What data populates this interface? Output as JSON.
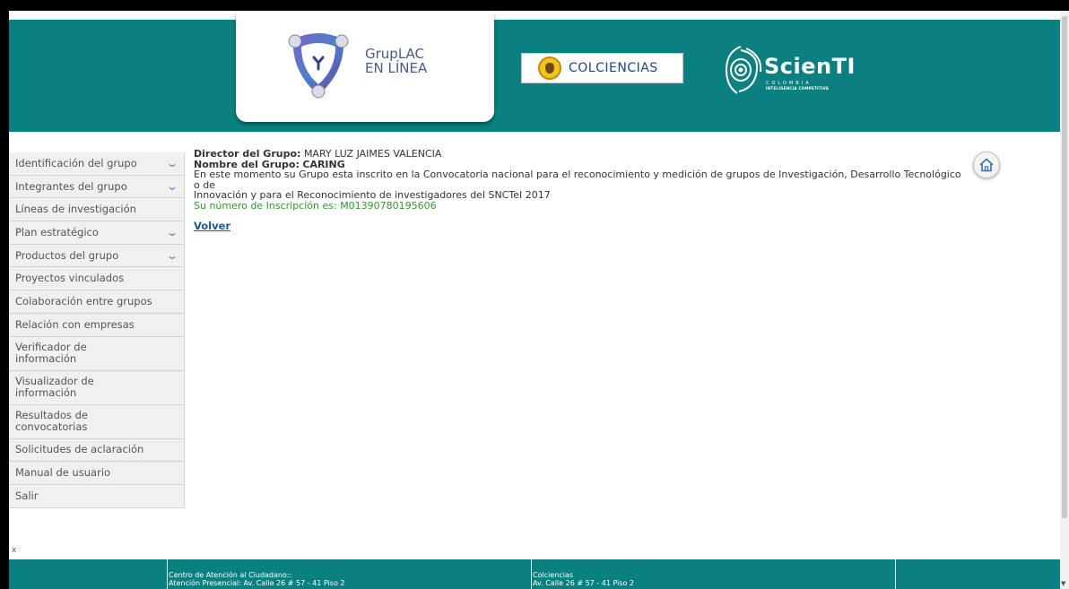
{
  "header": {
    "app_name_line1": "GrupLAC",
    "app_name_line2": "EN LÍNEA",
    "partner_logo_text": "COLCIENCIAS",
    "scienti_name": "ScienTI",
    "scienti_sub1": "COLOMBIA",
    "scienti_sub2": "INTELIGENCIA COMPETITIVA",
    "accent_color": "#0b8080"
  },
  "sidebar": {
    "items": [
      {
        "label": "Identificación del grupo",
        "expandable": true
      },
      {
        "label": "Integrantes del grupo",
        "expandable": true
      },
      {
        "label": "Líneas de investigación",
        "expandable": false
      },
      {
        "label": "Plan estratégico",
        "expandable": true
      },
      {
        "label": "Productos del grupo",
        "expandable": true
      },
      {
        "label": "Proyectos vinculados",
        "expandable": false
      },
      {
        "label": "Colaboración entre grupos",
        "expandable": false
      },
      {
        "label": "Relación con empresas",
        "expandable": false
      },
      {
        "label": "Verificador de información",
        "expandable": false
      },
      {
        "label": "Visualizador de información",
        "expandable": false
      },
      {
        "label": "Resultados de convocatorias",
        "expandable": false
      },
      {
        "label": "Solicitudes de aclaración",
        "expandable": false
      },
      {
        "label": "Manual de usuario",
        "expandable": false
      },
      {
        "label": "Salir",
        "expandable": false
      }
    ]
  },
  "main": {
    "director_label": "Director del Grupo:",
    "director_value": "MARY LUZ JAIMES VALENCIA",
    "group_label": "Nombre del Grupo:",
    "group_value": "CARING",
    "message_line1": "En este momento su Grupo esta inscrito en la Convocatoria nacional para el reconocimiento y medición de grupos de Investigación, Desarrollo Tecnológico o de",
    "message_line2": "Innovación y para el Reconocimiento de investigadores del SNCTeI 2017",
    "inscription": "Su número de Inscripción es: M01390780195606",
    "back_link": "Volver"
  },
  "close_glyph": "x",
  "footer": {
    "col1_title": "Centro de Atención al Ciudadano::",
    "col1_line": "Atención Presencial: Av. Calle 26 # 57 - 41 Piso 2",
    "col2_title": "Colciencias",
    "col2_line": "Av. Calle 26 # 57 - 41 Piso 2"
  }
}
